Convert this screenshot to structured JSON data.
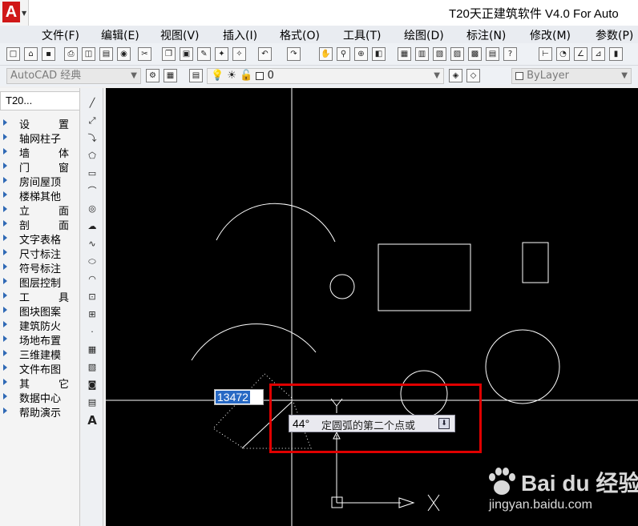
{
  "window": {
    "title": "T20天正建筑软件 V4.0 For Auto"
  },
  "app_button": {
    "logo_letter": "A"
  },
  "menu": {
    "items": [
      "文件(F)",
      "编辑(E)",
      "视图(V)",
      "插入(I)",
      "格式(O)",
      "工具(T)",
      "绘图(D)",
      "标注(N)",
      "修改(M)",
      "参数(P)"
    ]
  },
  "toolbar2": {
    "workspace": "AutoCAD 经典",
    "layer": "0",
    "linetype": "ByLayer"
  },
  "t20_panel": {
    "title": "T20...",
    "items": [
      "设置",
      "轴网柱子",
      "墙体",
      "门窗",
      "房间屋顶",
      "楼梯其他",
      "立面",
      "剖面",
      "文字表格",
      "尺寸标注",
      "符号标注",
      "图层控制",
      "工具",
      "图块图案",
      "建筑防火",
      "场地布置",
      "三维建模",
      "文件布图",
      "其它",
      "数据中心",
      "帮助演示"
    ]
  },
  "drawbar": {
    "text_tool_glyph": "A"
  },
  "canvas": {
    "dynamic_input_value": "13472",
    "tooltip_angle": "44°",
    "tooltip_prompt": "定圆弧的第二个点或",
    "ucs_x_label": "X",
    "ucs_y_label": "Y",
    "highlight_color": "#e00000"
  },
  "watermark": {
    "brand": "Bai du 经验",
    "url": "jingyan.baidu.com"
  }
}
